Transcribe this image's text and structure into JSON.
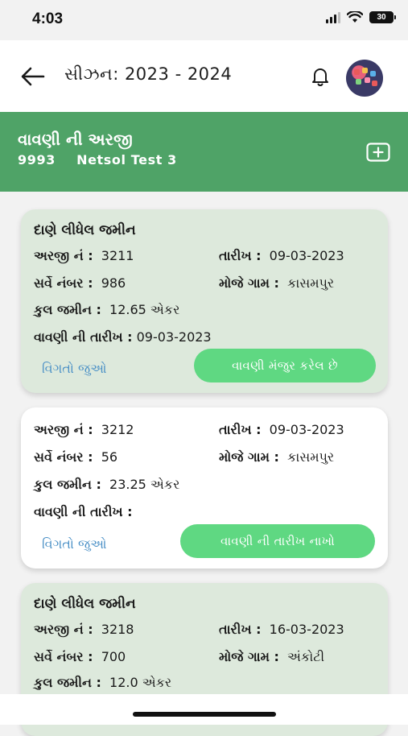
{
  "status_bar": {
    "time": "4:03",
    "battery": "30"
  },
  "header": {
    "title": "સીઝન: 2023 - 2024"
  },
  "banner": {
    "title": "વાવણી ની અરજી",
    "code": "9993",
    "name": "Netsol Test 3"
  },
  "labels": {
    "application_no": "અરજી નં :",
    "date": "તારીખ :",
    "survey_no": "સર્વે નંબર :",
    "village": "મોજે ગામ :",
    "total_land": "કુલ જમીન :",
    "sowing_date": "વાવણી ની તારીખ :",
    "details_link": "વિગતો જુઓ"
  },
  "cards": [
    {
      "heading": "દાણે લીધેલ જમીન",
      "application_no": "3211",
      "date": "09-03-2023",
      "survey_no": "986",
      "village": "કાસમપુર",
      "total_land": "12.65 એકર",
      "sowing_date": "09-03-2023",
      "action": "વાવણી મંજુર કરેલ છે"
    },
    {
      "heading": "",
      "application_no": "3212",
      "date": "09-03-2023",
      "survey_no": "56",
      "village": "કાસમપુર",
      "total_land": "23.25 એકર",
      "sowing_date": "",
      "action": "વાવણી ની તારીખ નાખો"
    },
    {
      "heading": "દાણે લીધેલ જમીન",
      "application_no": "3218",
      "date": "16-03-2023",
      "survey_no": "700",
      "village": "અંકોટી",
      "total_land": "12.0 એકર"
    }
  ],
  "colors": {
    "primary_green": "#4fa367",
    "button_green": "#5fd882",
    "tinted_card": "#dde9dc",
    "link_blue": "#4a90c6"
  }
}
